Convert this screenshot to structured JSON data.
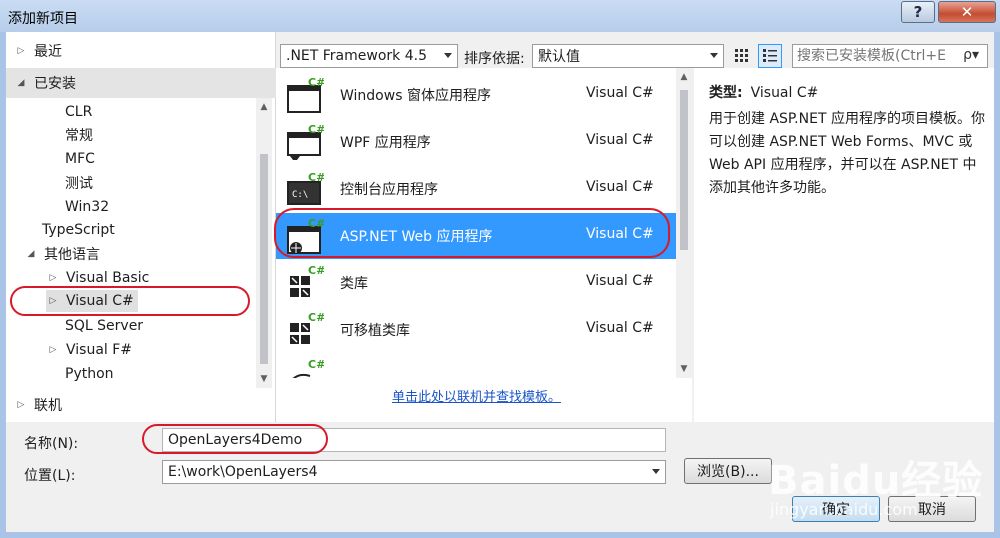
{
  "window": {
    "title": "添加新项目",
    "help_label": "?",
    "close_label": "✕"
  },
  "tree": {
    "recent": "最近",
    "installed": "已安装",
    "items": [
      {
        "label": "CLR",
        "arrow": ""
      },
      {
        "label": "常规",
        "arrow": ""
      },
      {
        "label": "MFC",
        "arrow": ""
      },
      {
        "label": "测试",
        "arrow": ""
      },
      {
        "label": "Win32",
        "arrow": ""
      },
      {
        "label": "TypeScript",
        "arrow": ""
      },
      {
        "label": "其他语言",
        "arrow": "◢"
      },
      {
        "label": "Visual Basic",
        "arrow": "▷"
      },
      {
        "label": "Visual C#",
        "arrow": "▷"
      },
      {
        "label": "SQL Server",
        "arrow": ""
      },
      {
        "label": "Visual F#",
        "arrow": "▷"
      },
      {
        "label": "Python",
        "arrow": ""
      }
    ],
    "online": "联机"
  },
  "toolbar": {
    "framework": ".NET Framework 4.5",
    "sort_label": "排序依据:",
    "sort_value": "默认值",
    "search_placeholder": "搜索已安装模板(Ctrl+E",
    "search_icon": "ρ▾"
  },
  "templates": [
    {
      "name": "Windows 窗体应用程序",
      "lang": "Visual C#",
      "icon": "window-app-icon"
    },
    {
      "name": "WPF 应用程序",
      "lang": "Visual C#",
      "icon": "wpf-app-icon"
    },
    {
      "name": "控制台应用程序",
      "lang": "Visual C#",
      "icon": "console-app-icon"
    },
    {
      "name": "ASP.NET Web 应用程序",
      "lang": "Visual C#",
      "icon": "web-app-icon"
    },
    {
      "name": "类库",
      "lang": "Visual C#",
      "icon": "class-library-icon"
    },
    {
      "name": "可移植类库",
      "lang": "Visual C#",
      "icon": "portable-library-icon"
    }
  ],
  "template_badge": "C#",
  "online_link": "单击此处以联机并查找模板。",
  "description": {
    "type_label": "类型:",
    "type_value": "Visual C#",
    "text": "用于创建 ASP.NET 应用程序的项目模板。你可以创建 ASP.NET Web Forms、MVC 或 Web API 应用程序，并可以在 ASP.NET 中添加其他许多功能。"
  },
  "form": {
    "name_label": "名称(N):",
    "name_value": "OpenLayers4Demo",
    "location_label": "位置(L):",
    "location_value": "E:\\work\\OpenLayers4",
    "browse_label": "浏览(B)...",
    "ok_label": "确定",
    "cancel_label": "取消"
  },
  "watermark": {
    "text": "Baidu经验",
    "sub": "jingyan.baidu.com"
  },
  "colors": {
    "selection": "#3399ff",
    "annotation": "#d8192a"
  }
}
